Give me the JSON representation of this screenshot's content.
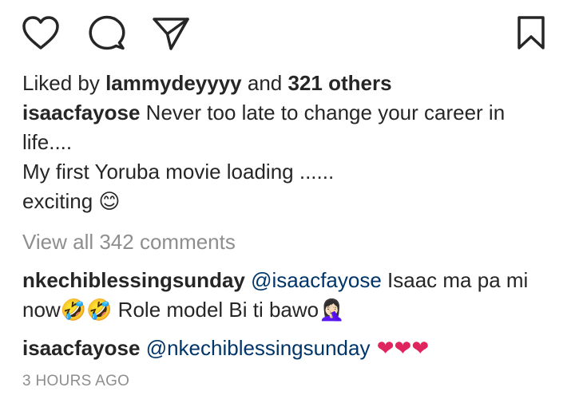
{
  "actions": {
    "like_icon": "heart-outline-icon",
    "comment_icon": "speech-bubble-icon",
    "share_icon": "paper-plane-icon",
    "save_icon": "bookmark-icon"
  },
  "likes": {
    "prefix": "Liked by ",
    "user": "lammydeyyyy",
    "middle": " and ",
    "others": "321 others"
  },
  "caption": {
    "username": "isaacfayose",
    "line1": " Never too late to change your career in life....",
    "line2": "My first Yoruba movie loading ......",
    "line3": "exciting ",
    "emoji": "😊"
  },
  "view_comments": "View all 342 comments",
  "comments": [
    {
      "username": "nkechiblessingsunday",
      "mention": "@isaacfayose",
      "text1": " Isaac ma pa mi now",
      "emoji1": "🤣🤣",
      "text2": " Role model Bi ti bawo",
      "emoji2": "🤦🏻‍♀️"
    },
    {
      "username": "isaacfayose",
      "mention": "@nkechiblessingsunday",
      "hearts": " ❤❤❤"
    }
  ],
  "timestamp": "3 HOURS AGO",
  "colors": {
    "text": "#262626",
    "muted": "#8e8e8e",
    "mention": "#003569",
    "heart": "#e0245e"
  }
}
